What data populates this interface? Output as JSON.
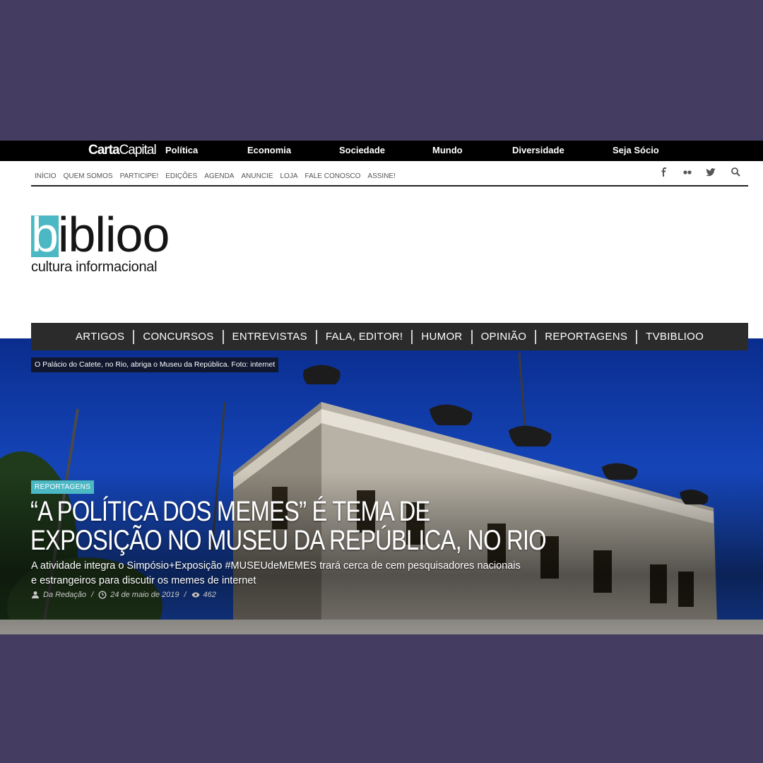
{
  "topbar": {
    "brand_part1": "Carta",
    "brand_part2": "Capital",
    "links": [
      "Política",
      "Economia",
      "Sociedade",
      "Mundo",
      "Diversidade",
      "Seja Sócio"
    ]
  },
  "subnav": {
    "links": [
      "INÍCIO",
      "QUEM SOMOS",
      "PARTICIPE!",
      "EDIÇÕES",
      "AGENDA",
      "ANUNCIE",
      "LOJA",
      "FALE CONOSCO",
      "ASSINE!"
    ]
  },
  "social": {
    "icons": [
      "facebook-icon",
      "flickr-icon",
      "twitter-icon",
      "search-icon"
    ]
  },
  "logo": {
    "word_b": "b",
    "word_rest": "iblioo",
    "tagline": "cultura informacional"
  },
  "categories": [
    "ARTIGOS",
    "CONCURSOS",
    "ENTREVISTAS",
    "FALA, EDITOR!",
    "HUMOR",
    "OPINIÃO",
    "REPORTAGENS",
    "TVBIBLIOO"
  ],
  "hero": {
    "caption": "O Palácio do Catete, no Rio, abriga o Museu da República. Foto: internet",
    "badge": "REPORTAGENS",
    "headline_line1": "“A POLÍTICA DOS MEMES” É TEMA DE",
    "headline_line2": "EXPOSIÇÃO NO MUSEU DA REPÚBLICA, NO RIO",
    "deck": "A atividade integra o Simpósio+Exposição #MUSEUdeMEMES trará cerca de cem pesquisadores nacionais e estrangeiros para discutir os memes de internet",
    "author": "Da Redação",
    "date": "24 de maio de 2019",
    "views": "462"
  },
  "colors": {
    "accent": "#4cb8c4",
    "frame": "#453c62",
    "nav_dark": "#2b2b2b"
  }
}
